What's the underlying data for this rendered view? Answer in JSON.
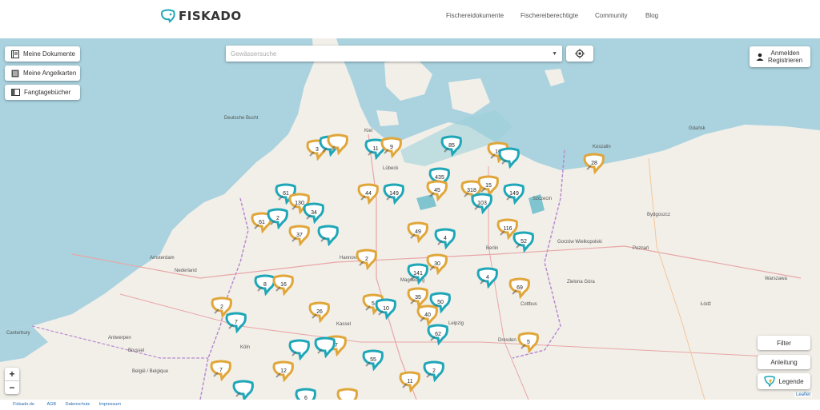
{
  "brand": {
    "name": "FISKADO",
    "accent": "#1fa7b8"
  },
  "nav": [
    "Fischereidokumente",
    "Fischereiberechtigte",
    "Community",
    "Blog"
  ],
  "left_controls": {
    "documents": "Meine Dokumente",
    "fishing_cards": "Meine Angelkarten",
    "logbooks": "Fangtagebücher"
  },
  "search": {
    "placeholder": "Gewässersuche"
  },
  "account": {
    "login": "Anmelden",
    "register": "Registrieren"
  },
  "right_controls": {
    "filter": "Filter",
    "guide": "Anleitung",
    "legend": "Legende"
  },
  "zoom": {
    "in": "+",
    "out": "−"
  },
  "attribution": "Leaflet",
  "footer": {
    "site": "Fiskado.de",
    "agb": "AGB",
    "privacy": "Datenschutz",
    "imprint": "Impressum"
  },
  "map_labels": [
    "Deutsche Bucht",
    "Kiel",
    "Lübeck",
    "Szczecin",
    "Gdańsk",
    "Bydgoszcz",
    "Amsterdam",
    "Nederland",
    "Hannover",
    "Berlin",
    "Magdeburg",
    "Leipzig",
    "Dresden",
    "Antwerpen",
    "Brussel",
    "België / Belgique",
    "Canterbury",
    "Köln",
    "Kassel",
    "Cottbus",
    "Poznań",
    "Warszawa",
    "Łódź",
    "Zielona Góra",
    "Koszalin",
    "Gorzów Wielkopolski"
  ],
  "markers": [
    {
      "label": "3",
      "color": "gold"
    },
    {
      "label": "",
      "color": "teal"
    },
    {
      "label": "",
      "color": "gold"
    },
    {
      "label": "11",
      "color": "teal"
    },
    {
      "label": "9",
      "color": "gold"
    },
    {
      "label": "85",
      "color": "teal"
    },
    {
      "label": "16",
      "color": "gold"
    },
    {
      "label": "",
      "color": "teal"
    },
    {
      "label": "28",
      "color": "gold"
    },
    {
      "label": "61",
      "color": "teal"
    },
    {
      "label": "130",
      "color": "gold"
    },
    {
      "label": "34",
      "color": "teal"
    },
    {
      "label": "44",
      "color": "gold"
    },
    {
      "label": "149",
      "color": "teal"
    },
    {
      "label": "435",
      "color": "teal"
    },
    {
      "label": "45",
      "color": "gold"
    },
    {
      "label": "318",
      "color": "gold"
    },
    {
      "label": "15",
      "color": "gold"
    },
    {
      "label": "103",
      "color": "teal"
    },
    {
      "label": "149",
      "color": "teal"
    },
    {
      "label": "61",
      "color": "gold"
    },
    {
      "label": "2",
      "color": "teal"
    },
    {
      "label": "37",
      "color": "gold"
    },
    {
      "label": "",
      "color": "teal"
    },
    {
      "label": "49",
      "color": "gold"
    },
    {
      "label": "4",
      "color": "teal"
    },
    {
      "label": "116",
      "color": "gold"
    },
    {
      "label": "52",
      "color": "teal"
    },
    {
      "label": "2",
      "color": "gold"
    },
    {
      "label": "30",
      "color": "gold"
    },
    {
      "label": "141",
      "color": "teal"
    },
    {
      "label": "4",
      "color": "teal"
    },
    {
      "label": "69",
      "color": "gold"
    },
    {
      "label": "8",
      "color": "teal"
    },
    {
      "label": "16",
      "color": "gold"
    },
    {
      "label": "35",
      "color": "gold"
    },
    {
      "label": "50",
      "color": "teal"
    },
    {
      "label": "26",
      "color": "gold"
    },
    {
      "label": "5",
      "color": "gold"
    },
    {
      "label": "10",
      "color": "teal"
    },
    {
      "label": "40",
      "color": "gold"
    },
    {
      "label": "2",
      "color": "gold"
    },
    {
      "label": "7",
      "color": "teal"
    },
    {
      "label": "62",
      "color": "teal"
    },
    {
      "label": "",
      "color": "teal"
    },
    {
      "label": "7",
      "color": "gold"
    },
    {
      "label": "",
      "color": "teal"
    },
    {
      "label": "55",
      "color": "teal"
    },
    {
      "label": "5",
      "color": "gold"
    },
    {
      "label": "7",
      "color": "gold"
    },
    {
      "label": "12",
      "color": "gold"
    },
    {
      "label": "2",
      "color": "teal"
    },
    {
      "label": "11",
      "color": "gold"
    },
    {
      "label": "6",
      "color": "teal"
    },
    {
      "label": "",
      "color": "gold"
    },
    {
      "label": "",
      "color": "teal"
    }
  ]
}
